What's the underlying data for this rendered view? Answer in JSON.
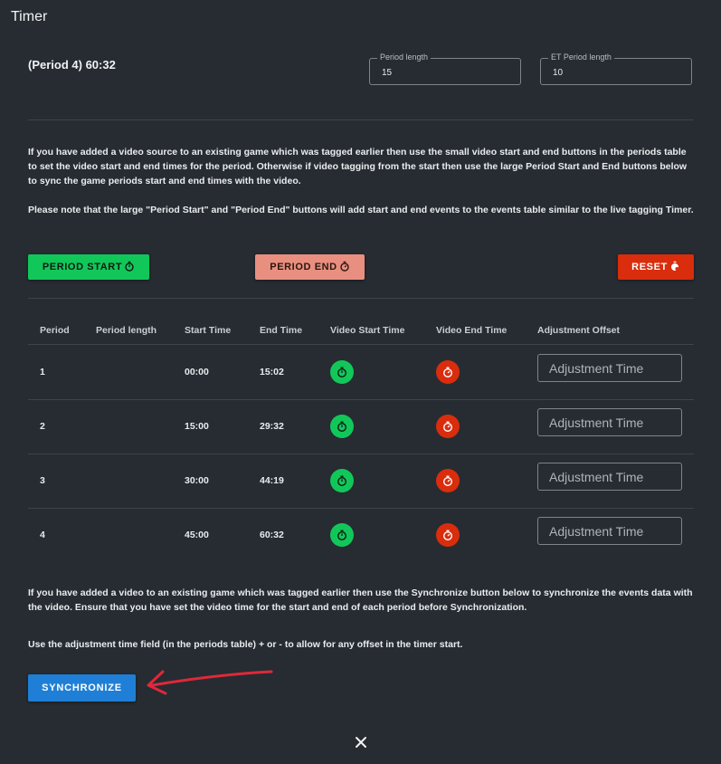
{
  "header": {
    "title": "Timer"
  },
  "status": {
    "current_period": "(Period 4) 60:32"
  },
  "fields": {
    "period_length": {
      "label": "Period length",
      "value": "15"
    },
    "et_period_length": {
      "label": "ET Period length",
      "value": "10"
    }
  },
  "instructions": {
    "p1": "If you have added a video source to an existing game which was tagged earlier then use the small video start and end buttons in the periods table to set the video start and end times for the period. Otherwise if video tagging from the start then use the large Period Start and End buttons below to sync the game periods start and end times with the video.",
    "p2": "Please note that the large \"Period Start\" and \"Period End\" buttons will add start and end events to the events table similar to the live tagging Timer."
  },
  "buttons": {
    "period_start": "PERIOD START",
    "period_end": "PERIOD END",
    "reset": "RESET",
    "synchronize": "SYNCHRONIZE"
  },
  "table": {
    "headers": [
      "Period",
      "Period length",
      "Start Time",
      "End Time",
      "Video Start Time",
      "Video End Time",
      "Adjustment Offset"
    ],
    "rows": [
      {
        "period": "1",
        "period_length": "",
        "start": "00:00",
        "end": "15:02",
        "adjust_placeholder": "Adjustment Time"
      },
      {
        "period": "2",
        "period_length": "",
        "start": "15:00",
        "end": "29:32",
        "adjust_placeholder": "Adjustment Time"
      },
      {
        "period": "3",
        "period_length": "",
        "start": "30:00",
        "end": "44:19",
        "adjust_placeholder": "Adjustment Time"
      },
      {
        "period": "4",
        "period_length": "",
        "start": "45:00",
        "end": "60:32",
        "adjust_placeholder": "Adjustment Time"
      }
    ]
  },
  "sync_info": {
    "p1": "If you have added a video to an existing game which was tagged earlier then use the Synchronize button below to synchronize the events data with the video. Ensure that you have set the video time for the start and end of each period before Synchronization.",
    "p2": "Use the adjustment time field (in the periods table) + or - to allow for any offset in the timer start."
  },
  "icons": {
    "video_start": "stopwatch-start-icon",
    "video_end": "stopwatch-end-icon",
    "close": "close-icon"
  },
  "colors": {
    "background": "#262c31",
    "start_green": "#12c75a",
    "end_salmon": "#e98f7f",
    "reset_red": "#d92d0d",
    "sync_blue": "#1f7fd6",
    "annotation_arrow": "#e0283a"
  }
}
